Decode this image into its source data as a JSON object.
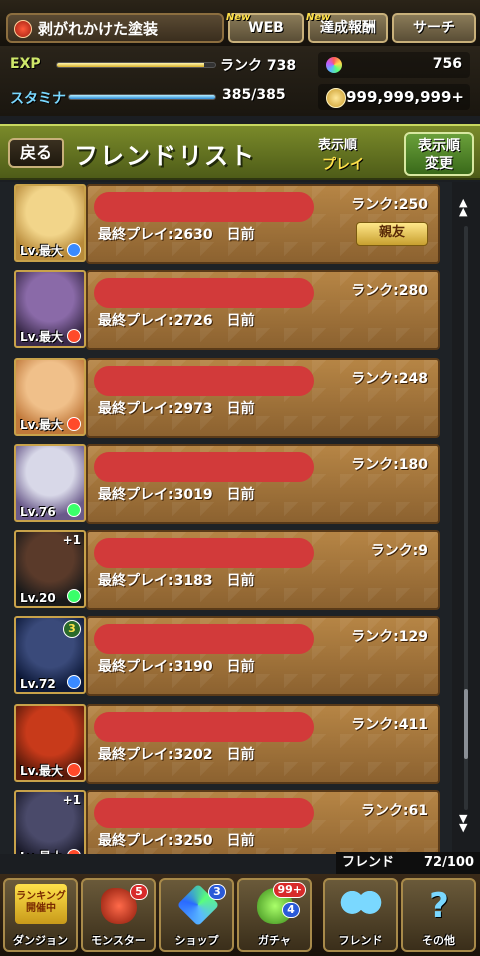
{
  "topbar": {
    "dungeon_title": "剥がれかけた塗装",
    "new_tag": "New",
    "web_label": "WEB",
    "rewards_label": "達成報酬",
    "search_label": "サーチ"
  },
  "status": {
    "exp_label": "EXP",
    "rank_text": "ランク 738",
    "exp_progress": 0.93,
    "stamina_label": "スタミナ",
    "stamina_text": "385/385",
    "stamina_progress": 1.0,
    "magic_stones": "756",
    "coins": "999,999,999+"
  },
  "header": {
    "back_label": "戻る",
    "title": "フレンドリスト",
    "sort_label": "表示順",
    "sort_value": "プレイ",
    "sort_button_line1": "表示順",
    "sort_button_line2": "変更"
  },
  "friends": [
    {
      "level": "Lv.最大",
      "last_play": "最終プレイ:2630　日前",
      "rank": "ランク:250",
      "badge": "親友",
      "plus": "",
      "num": "",
      "orb": "#3a8aff",
      "avatar_colors": [
        "#f2d58a",
        "#b88a3a"
      ]
    },
    {
      "level": "Lv.最大",
      "last_play": "最終プレイ:2726　日前",
      "rank": "ランク:280",
      "badge": "",
      "plus": "",
      "num": "",
      "orb": "#ff4a2a",
      "avatar_colors": [
        "#8a6aa8",
        "#3a2a4a"
      ]
    },
    {
      "level": "Lv.最大",
      "last_play": "最終プレイ:2973　日前",
      "rank": "ランク:248",
      "badge": "",
      "plus": "",
      "num": "",
      "orb": "#ff4a2a",
      "avatar_colors": [
        "#f0c08a",
        "#c0783a"
      ]
    },
    {
      "level": "Lv.76",
      "last_play": "最終プレイ:3019　日前",
      "rank": "ランク:180",
      "badge": "",
      "plus": "",
      "num": "",
      "orb": "#3aff6a",
      "avatar_colors": [
        "#d8d8e8",
        "#6a5a8a"
      ]
    },
    {
      "level": "Lv.20",
      "last_play": "最終プレイ:3183　日前",
      "rank": "ランク:9",
      "badge": "",
      "plus": "+1",
      "num": "",
      "orb": "#3aff6a",
      "avatar_colors": [
        "#5a3a2a",
        "#1a1a1a"
      ]
    },
    {
      "level": "Lv.72",
      "last_play": "最終プレイ:3190　日前",
      "rank": "ランク:129",
      "badge": "",
      "plus": "",
      "num": "3",
      "orb": "#3a8aff",
      "avatar_colors": [
        "#3a4a7a",
        "#0e1a3a"
      ]
    },
    {
      "level": "Lv.最大",
      "last_play": "最終プレイ:3202　日前",
      "rank": "ランク:411",
      "badge": "",
      "plus": "",
      "num": "",
      "orb": "#ff4a2a",
      "avatar_colors": [
        "#c83a1a",
        "#5a1a0a"
      ]
    },
    {
      "level": "Lv.最大",
      "last_play": "最終プレイ:3250　日前",
      "rank": "ランク:61",
      "badge": "",
      "plus": "+1",
      "num": "",
      "orb": "#ff4a2a",
      "avatar_colors": [
        "#4a4a6a",
        "#1a1a2a"
      ]
    }
  ],
  "scroll": {
    "position": 0.9
  },
  "footer": {
    "count_label": "フレンド",
    "count_value": "72/100"
  },
  "nav": [
    {
      "label": "ダンジョン",
      "top": "ランキング",
      "top2": "開催中",
      "badge": ""
    },
    {
      "label": "モンスター",
      "badge": "5"
    },
    {
      "label": "ショップ",
      "badge": "3"
    },
    {
      "label": "ガチャ",
      "badge": "99+",
      "badge2": "4"
    },
    {
      "label": "フレンド",
      "badge": ""
    },
    {
      "label": "その他",
      "badge": ""
    }
  ]
}
